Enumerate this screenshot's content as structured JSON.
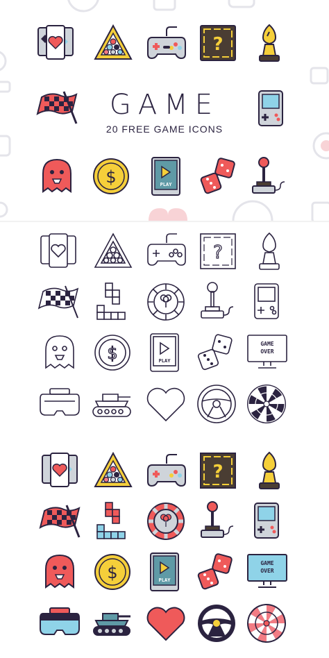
{
  "header": {
    "title": "GAME",
    "subtitle": "20 FREE GAME ICONS"
  },
  "icon_labels": {
    "play": "PLAY",
    "game_over_line1": "GAME",
    "game_over_line2": "OVER"
  },
  "colors": {
    "outline": "#2b2340",
    "red": "#ef5a5a",
    "pink": "#f27c84",
    "yellow": "#f5cf3a",
    "blue": "#8fd3e8",
    "gray": "#cfd4da",
    "brown": "#4a3d33",
    "teal": "#5f9aa6",
    "faded": "#e8e8ee"
  },
  "icon_sets": [
    {
      "style": "filled",
      "icons": [
        "cards-icon",
        "billiard-triangle-icon",
        "gamepad-icon",
        "mystery-box-icon",
        "chess-bishop-icon",
        "checkered-flag-icon",
        "handheld-console-icon",
        "ghost-icon",
        "coin-icon",
        "tablet-play-icon",
        "dice-icon",
        "joystick-icon"
      ]
    },
    {
      "style": "outline",
      "icons": [
        "cards-icon",
        "billiard-triangle-icon",
        "gamepad-icon",
        "mystery-box-icon",
        "chess-bishop-icon",
        "checkered-flag-icon",
        "tetris-blocks-icon",
        "casino-chip-icon",
        "joystick-icon",
        "handheld-console-icon",
        "ghost-icon",
        "coin-icon",
        "tablet-play-icon",
        "dice-icon",
        "monitor-game-over-icon",
        "vr-headset-icon",
        "tank-icon",
        "heart-icon",
        "steering-wheel-icon",
        "dartboard-icon"
      ]
    },
    {
      "style": "filled",
      "icons": [
        "cards-icon",
        "billiard-triangle-icon",
        "gamepad-icon",
        "mystery-box-icon",
        "chess-bishop-icon",
        "checkered-flag-icon",
        "tetris-blocks-icon",
        "casino-chip-icon",
        "joystick-icon",
        "handheld-console-icon",
        "ghost-icon",
        "coin-icon",
        "tablet-play-icon",
        "dice-icon",
        "monitor-game-over-icon",
        "vr-headset-icon",
        "tank-icon",
        "heart-icon",
        "steering-wheel-icon",
        "dartboard-icon"
      ]
    }
  ]
}
